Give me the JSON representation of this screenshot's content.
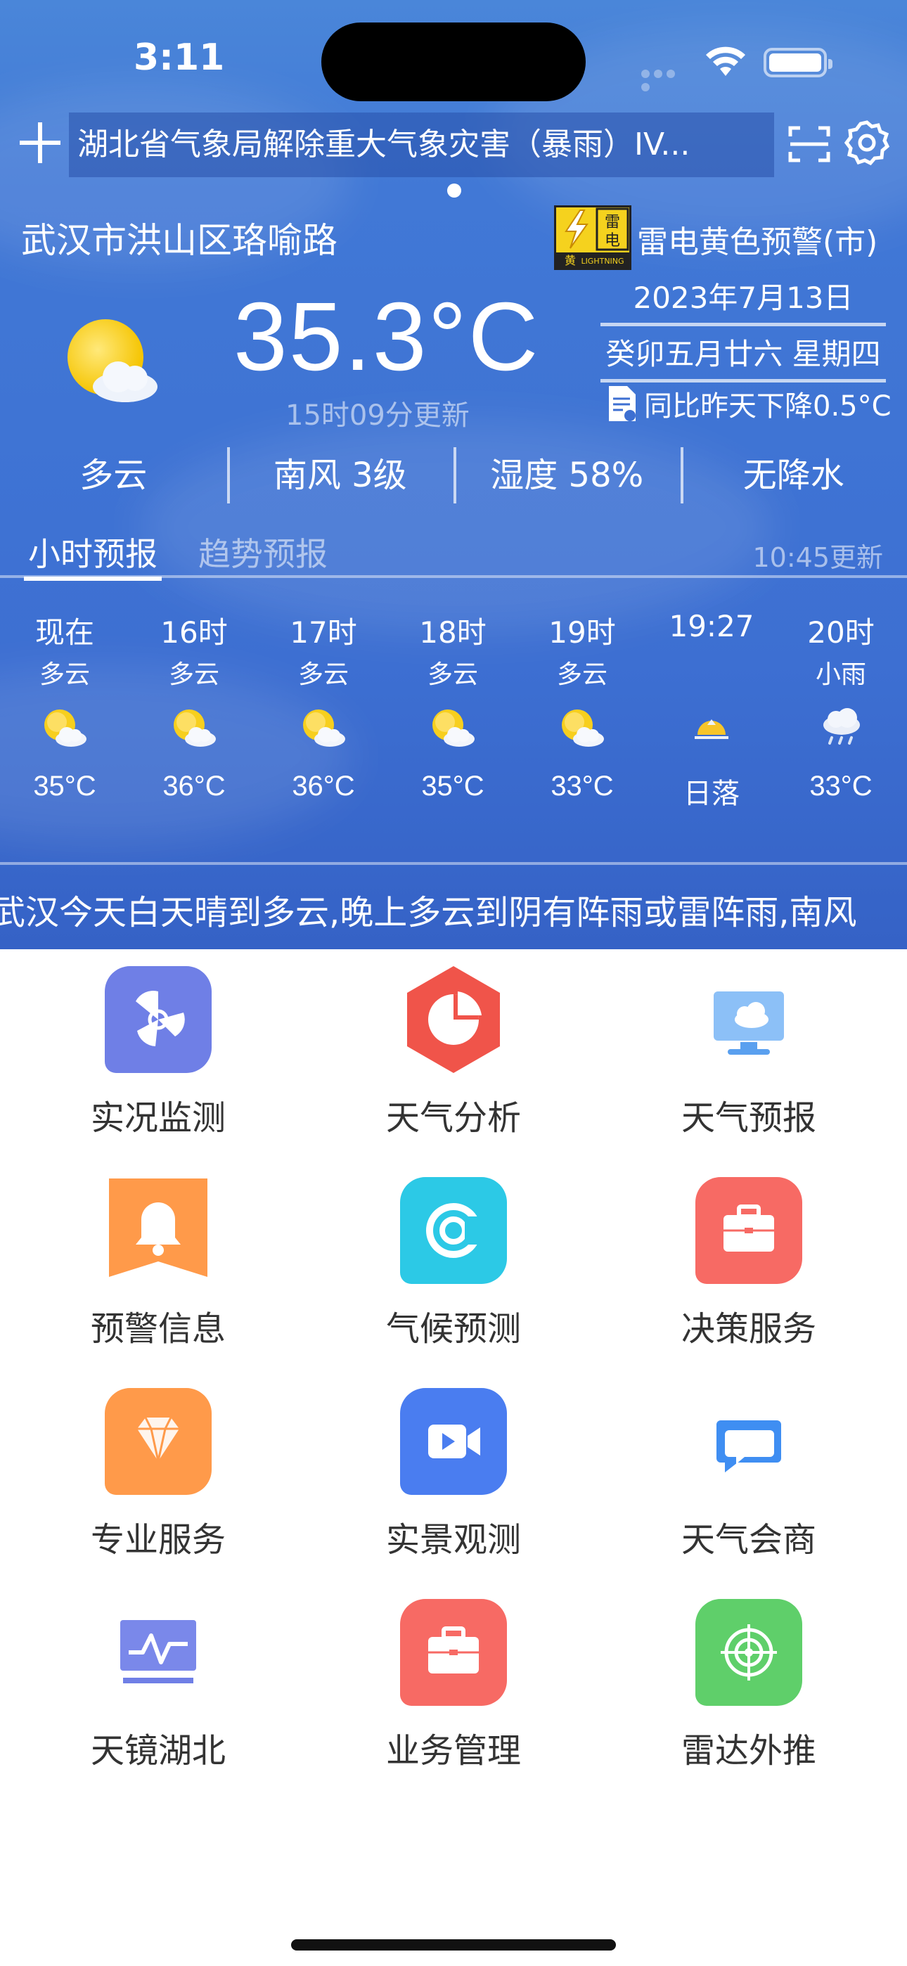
{
  "status_bar": {
    "time": "3:11"
  },
  "header": {
    "alert_banner": "湖北省气象局解除重大气象灾害（暴雨）IV..."
  },
  "current": {
    "location": "武汉市洪山区珞喻路",
    "warning": "雷电黄色预警(市)",
    "warning_badge": {
      "top_text": "雷电",
      "bottom_left": "黄",
      "bottom_right": "LIGHTNING",
      "color": "#f5d21e"
    },
    "temperature": "35.3°C",
    "updated": "15时09分更新",
    "date": "2023年7月13日",
    "lunar_date": "癸卯五月廿六 星期四",
    "compare": "同比昨天下降0.5°C",
    "stats": [
      "多云",
      "南风 3级",
      "湿度 58%",
      "无降水"
    ]
  },
  "forecast": {
    "tabs": [
      "小时预报",
      "趋势预报"
    ],
    "updated": "10:45更新",
    "hours": [
      {
        "time": "现在",
        "cond": "多云",
        "icon": "partly-cloudy-icon",
        "temp": "35°C"
      },
      {
        "time": "16时",
        "cond": "多云",
        "icon": "partly-cloudy-icon",
        "temp": "36°C"
      },
      {
        "time": "17时",
        "cond": "多云",
        "icon": "partly-cloudy-icon",
        "temp": "36°C"
      },
      {
        "time": "18时",
        "cond": "多云",
        "icon": "partly-cloudy-icon",
        "temp": "35°C"
      },
      {
        "time": "19时",
        "cond": "多云",
        "icon": "partly-cloudy-icon",
        "temp": "33°C"
      },
      {
        "time": "19:27",
        "cond": "",
        "icon": "sunset-icon",
        "temp": "日落"
      },
      {
        "time": "20时",
        "cond": "小雨",
        "icon": "light-rain-icon",
        "temp": "33°C"
      }
    ]
  },
  "ticker": "武汉今天白天晴到多云,晚上多云到阴有阵雨或雷阵雨,南风",
  "grid": [
    {
      "label": "实况监测",
      "icon": "fan-icon",
      "color": "#6f7fe6"
    },
    {
      "label": "天气分析",
      "icon": "pie-chart-icon",
      "color": "#f0544a"
    },
    {
      "label": "天气预报",
      "icon": "monitor-cloud-icon",
      "color": "#5aa0ef"
    },
    {
      "label": "预警信息",
      "icon": "bell-icon",
      "color": "#ff9a4a"
    },
    {
      "label": "气候预测",
      "icon": "climate-icon",
      "color": "#2cc9e6"
    },
    {
      "label": "决策服务",
      "icon": "briefcase-icon",
      "color": "#f76a64"
    },
    {
      "label": "专业服务",
      "icon": "diamond-icon",
      "color": "#ff9a4a"
    },
    {
      "label": "实景观测",
      "icon": "video-icon",
      "color": "#4a7df0"
    },
    {
      "label": "天气会商",
      "icon": "chat-icon",
      "color": "#3f8ef2"
    },
    {
      "label": "天镜湖北",
      "icon": "waveform-icon",
      "color": "#6f7fe6"
    },
    {
      "label": "业务管理",
      "icon": "briefcase-icon",
      "color": "#f76a64"
    },
    {
      "label": "雷达外推",
      "icon": "radar-icon",
      "color": "#5fcf6a"
    }
  ]
}
